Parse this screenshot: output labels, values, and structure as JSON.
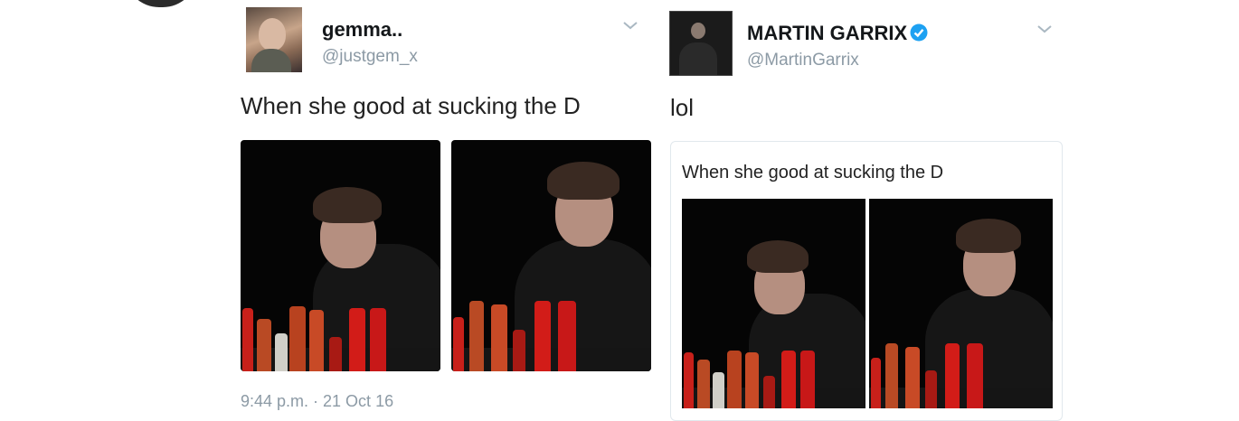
{
  "left_tweet": {
    "name": "gemma..",
    "handle": "@justgem_x",
    "text": "When she good at sucking the D",
    "timestamp": "9:44 p.m. · 21 Oct 16",
    "media_count": 2
  },
  "right_tweet": {
    "name": "MARTIN GARRIX",
    "verified": true,
    "handle": "@MartinGarrix",
    "text": "lol",
    "quoted": {
      "text": "When she good at sucking the D",
      "media_count": 2
    }
  },
  "colors": {
    "verified_blue": "#1da1f2",
    "secondary_text": "#8c9aa5",
    "border": "#e1e8ed"
  },
  "icons": [
    "chevron-down-icon",
    "verified-badge-icon"
  ]
}
